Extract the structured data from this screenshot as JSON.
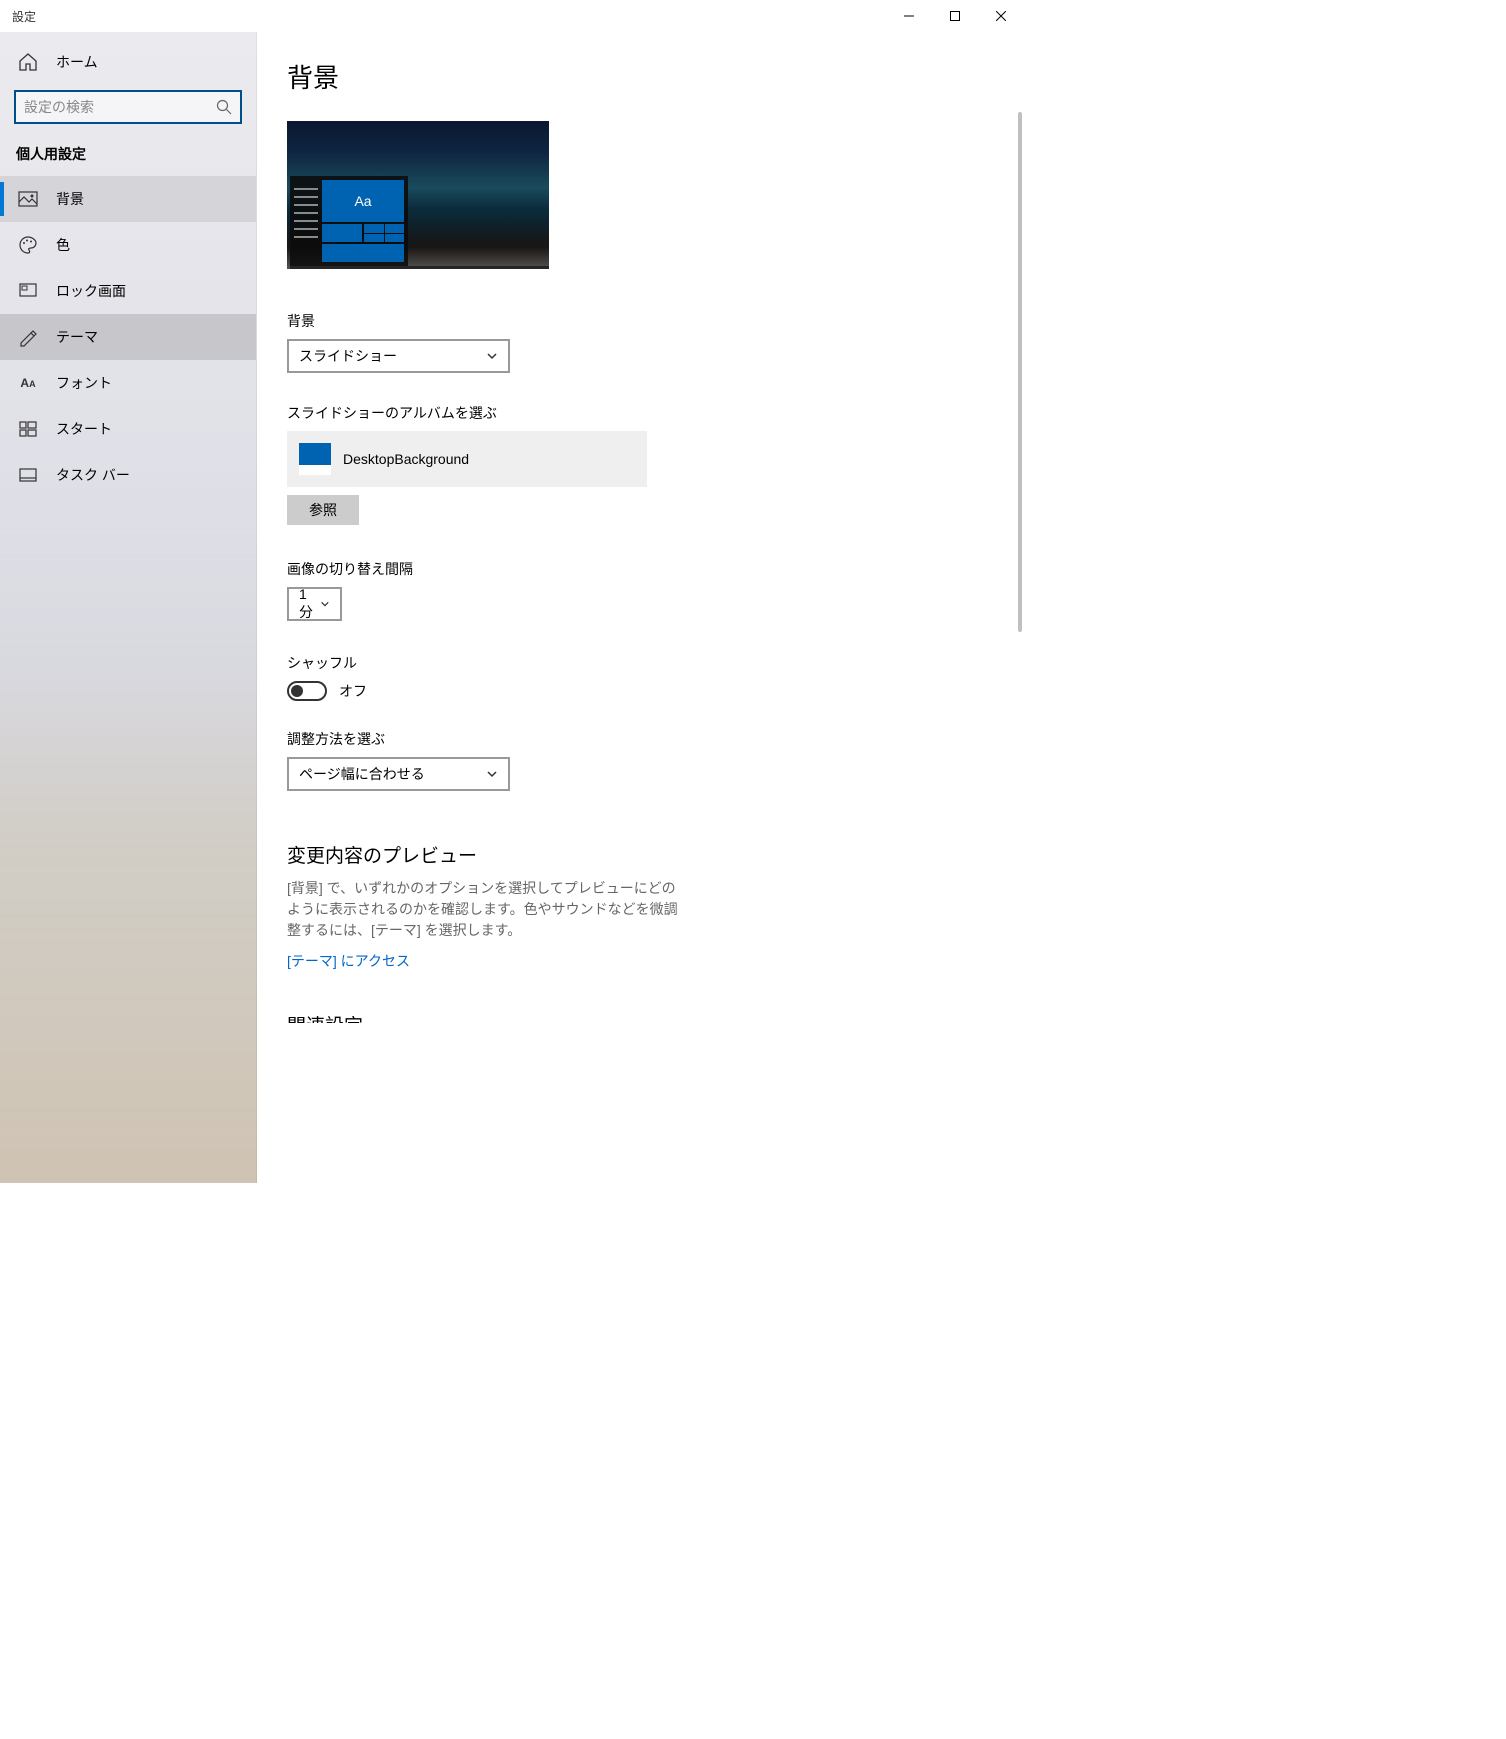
{
  "window": {
    "title": "設定"
  },
  "sidebar": {
    "home": "ホーム",
    "search_placeholder": "設定の検索",
    "section": "個人用設定",
    "items": [
      {
        "label": "背景"
      },
      {
        "label": "色"
      },
      {
        "label": "ロック画面"
      },
      {
        "label": "テーマ"
      },
      {
        "label": "フォント"
      },
      {
        "label": "スタート"
      },
      {
        "label": "タスク バー"
      }
    ]
  },
  "main": {
    "title": "背景",
    "preview_sample": "Aa",
    "background_label": "背景",
    "background_value": "スライドショー",
    "album_label": "スライドショーのアルバムを選ぶ",
    "album_name": "DesktopBackground",
    "browse_label": "参照",
    "interval_label": "画像の切り替え間隔",
    "interval_value": "1 分",
    "shuffle_label": "シャッフル",
    "shuffle_value": "オフ",
    "fit_label": "調整方法を選ぶ",
    "fit_value": "ページ幅に合わせる",
    "preview_heading": "変更内容のプレビュー",
    "preview_help": "[背景] で、いずれかのオプションを選択してプレビューにどのように表示されるのかを確認します。色やサウンドなどを微調整するには、[テーマ] を選択します。",
    "theme_link": "[テーマ] にアクセス",
    "related_heading": "関連設定"
  }
}
